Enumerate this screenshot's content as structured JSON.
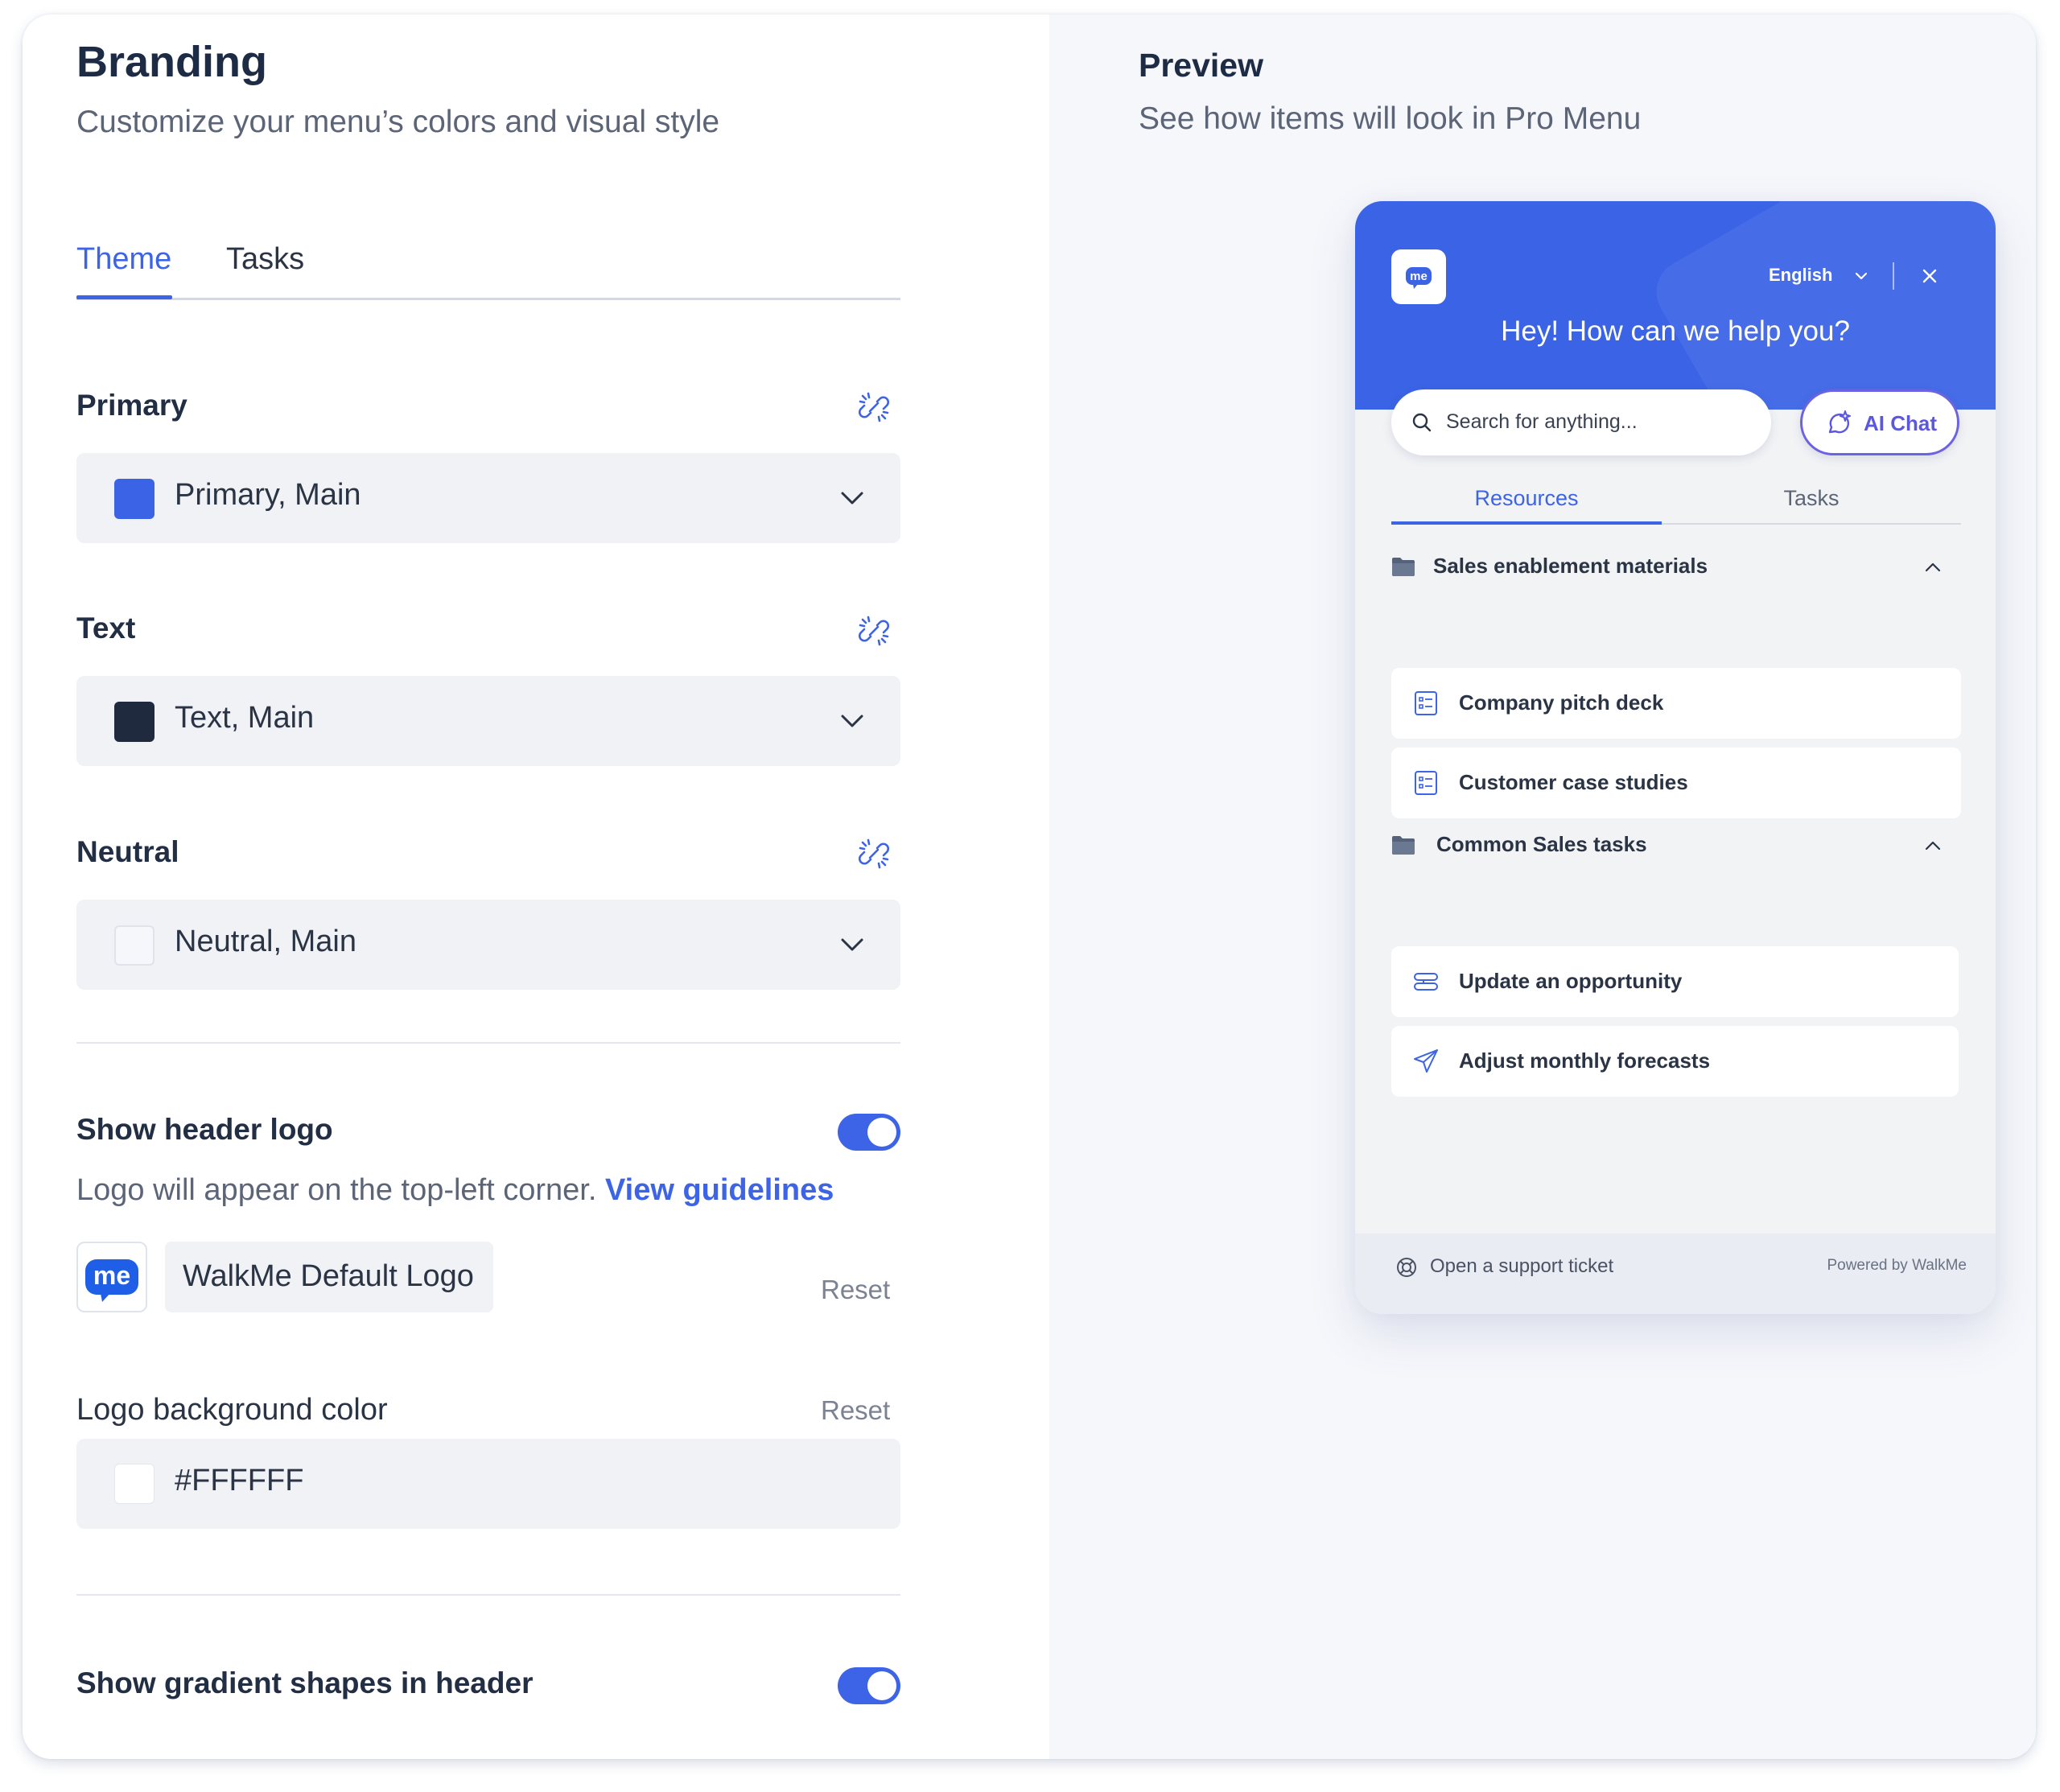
{
  "branding": {
    "title": "Branding",
    "subtitle": "Customize your menu’s colors and visual style",
    "tabs": [
      {
        "label": "Theme",
        "active": true
      },
      {
        "label": "Tasks",
        "active": false
      }
    ],
    "colors": [
      {
        "label": "Primary",
        "value": "Primary, Main",
        "swatch": "#3b63e6"
      },
      {
        "label": "Text",
        "value": "Text, Main",
        "swatch": "#1f2a3f"
      },
      {
        "label": "Neutral",
        "value": "Neutral, Main",
        "swatch": "#f6f7fa"
      }
    ],
    "show_header_logo": {
      "label": "Show header logo",
      "enabled": true,
      "description": "Logo will appear on the top-left corner.",
      "link": "View guidelines"
    },
    "logo": {
      "name": "WalkMe Default Logo",
      "reset": "Reset",
      "icon": "walkme-me-logo"
    },
    "logo_bg": {
      "label": "Logo background color",
      "reset": "Reset",
      "value": "#FFFFFF"
    },
    "gradient": {
      "label": "Show gradient shapes in header",
      "enabled": true
    }
  },
  "preview": {
    "title": "Preview",
    "subtitle": "See how items will look in Pro Menu",
    "widget": {
      "language": "English",
      "greeting": "Hey! How can we help you?",
      "search_placeholder": "Search for anything...",
      "ai_chat": "AI Chat",
      "tabs": [
        "Resources",
        "Tasks"
      ],
      "groups": [
        {
          "label": "Sales enablement materials",
          "items": [
            {
              "label": "Company pitch deck",
              "icon": "document-list-icon"
            },
            {
              "label": "Customer case studies",
              "icon": "document-list-icon"
            }
          ]
        },
        {
          "label": "Common Sales tasks",
          "items": [
            {
              "label": "Update an opportunity",
              "icon": "flow-icon"
            },
            {
              "label": "Adjust monthly forecasts",
              "icon": "send-icon"
            }
          ]
        }
      ],
      "footer_link": "Open a support ticket",
      "powered_by": "Powered by WalkMe"
    }
  },
  "theme_colors": {
    "accent": "#3d63e6",
    "ai_accent": "#5b57e0"
  }
}
